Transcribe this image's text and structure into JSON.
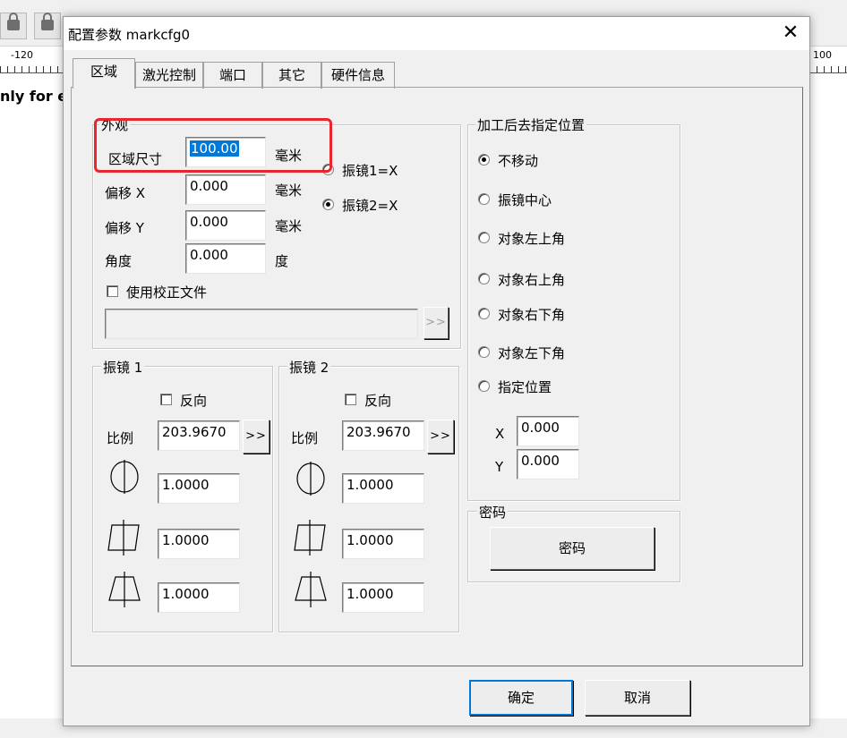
{
  "background_app": {
    "ruler_left": "-120",
    "ruler_right": "100",
    "canvas_text": "nly for ev"
  },
  "dialog": {
    "title": "配置参数 markcfg0",
    "close_icon": "✕",
    "tabs": [
      "区域",
      "激光控制",
      "端口",
      "其它",
      "硬件信息"
    ],
    "appearance": {
      "legend": "外观",
      "area_size_label": "区域尺寸",
      "area_size_value": "100.00",
      "area_size_unit": "毫米",
      "offset_x_label": "偏移 X",
      "offset_x_value": "0.000",
      "offset_x_unit": "毫米",
      "offset_y_label": "偏移 Y",
      "offset_y_value": "0.000",
      "offset_y_unit": "毫米",
      "angle_label": "角度",
      "angle_value": "0.000",
      "angle_unit": "度",
      "galvo1_x_label": "振镜1=X",
      "galvo2_x_label": "振镜2=X",
      "use_correction_label": "使用校正文件",
      "correction_path": "",
      "browse_label": ">>"
    },
    "galvo1": {
      "legend": "振镜 1",
      "reverse_label": "反向",
      "ratio_label": "比例",
      "ratio_value": "203.9670",
      "ratio_btn": ">>",
      "factor1": "1.0000",
      "factor2": "1.0000",
      "factor3": "1.0000"
    },
    "galvo2": {
      "legend": "振镜 2",
      "reverse_label": "反向",
      "ratio_label": "比例",
      "ratio_value": "203.9670",
      "ratio_btn": ">>",
      "factor1": "1.0000",
      "factor2": "1.0000",
      "factor3": "1.0000"
    },
    "after_process": {
      "legend": "加工后去指定位置",
      "options": [
        "不移动",
        "振镜中心",
        "对象左上角",
        "对象右上角",
        "对象右下角",
        "对象左下角",
        "指定位置"
      ],
      "selected": "不移动",
      "x_label": "X",
      "x_value": "0.000",
      "y_label": "Y",
      "y_value": "0.000"
    },
    "password": {
      "legend": "密码",
      "button": "密码"
    },
    "ok_label": "确定",
    "cancel_label": "取消"
  }
}
